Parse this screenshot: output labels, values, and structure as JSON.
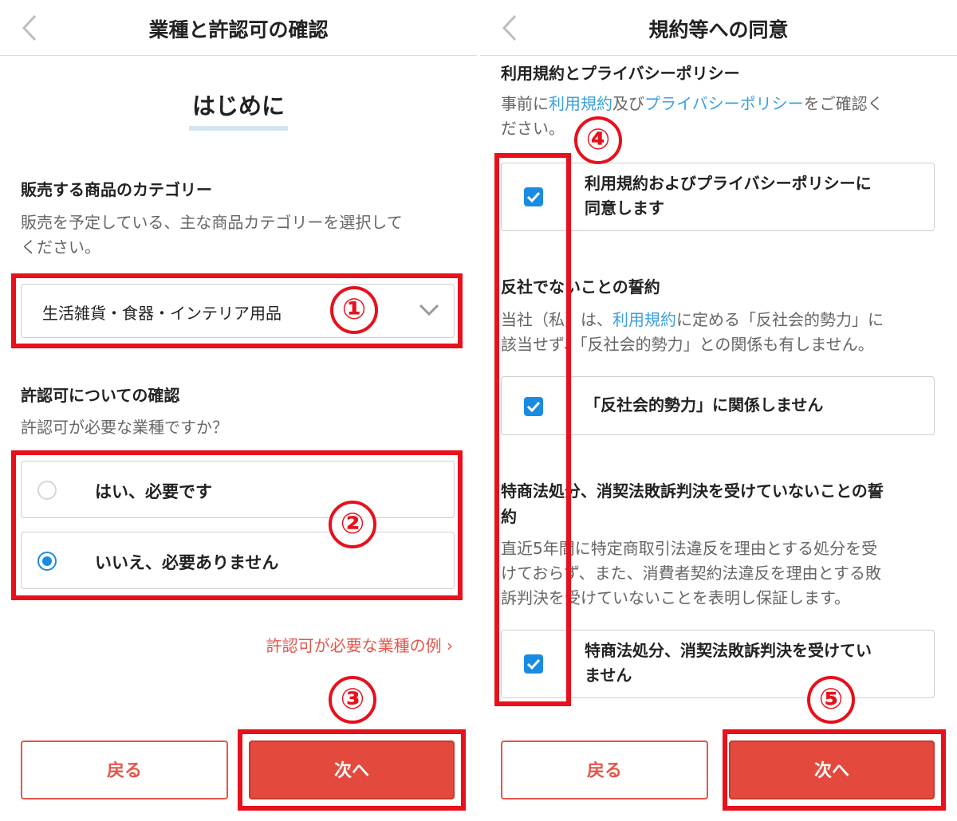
{
  "left": {
    "header_title": "業種と許認可の確認",
    "intro_title": "はじめに",
    "category": {
      "label": "販売する商品のカテゴリー",
      "desc_line1": "販売を予定している、主な商品カテゴリーを選択して",
      "desc_line2": "ください。",
      "selected_value": "生活雑貨・食器・インテリア用品"
    },
    "license": {
      "label": "許認可についての確認",
      "desc": "許認可が必要な業種ですか？",
      "options": [
        {
          "label": "はい、必要です",
          "selected": false
        },
        {
          "label": "いいえ、必要ありません",
          "selected": true
        }
      ]
    },
    "example_link": "許認可が必要な業種の例 ›",
    "back_button": "戻る",
    "next_button": "次へ",
    "badges": [
      "①",
      "②",
      "③"
    ]
  },
  "right": {
    "header_title": "規約等への同意",
    "terms": {
      "label": "利用規約とプライバシーポリシー",
      "desc_pre": "事前に",
      "link_terms": "利用規約",
      "desc_mid": "及び",
      "link_privacy": "プライバシーポリシー",
      "desc_post": "をご確認く",
      "desc_line2": "ださい。",
      "check_line1": "利用規約およびプライバシーポリシーに",
      "check_line2": "同意します"
    },
    "antisocial": {
      "label": "反社でないことの誓約",
      "desc_pre": "当社（私）は、",
      "link_terms": "利用規約",
      "desc_post": "に定める「反社会的勢力」に",
      "desc_line2": "該当せず、「反社会的勢力」との関係も有しません。",
      "check": "「反社会的勢力」に関係しません"
    },
    "tokusho": {
      "label_line1": "特商法処分、消契法敗訴判決を受けていないことの誓",
      "label_line2": "約",
      "desc_line1": "直近5年間に特定商取引法違反を理由とする処分を受",
      "desc_line2": "けておらず、また、消費者契約法違反を理由とする敗",
      "desc_line3": "訴判決を受けていないことを表明し保証します。",
      "check_line1": "特商法処分、消契法敗訴判決を受けてい",
      "check_line2": "ません"
    },
    "back_button": "戻る",
    "next_button": "次へ",
    "badges": [
      "④",
      "⑤"
    ]
  },
  "colors": {
    "accent_red": "#e34a3d",
    "annotation_red": "#e8101b",
    "link_blue": "#3aa0e0",
    "check_blue": "#1a8be2"
  }
}
